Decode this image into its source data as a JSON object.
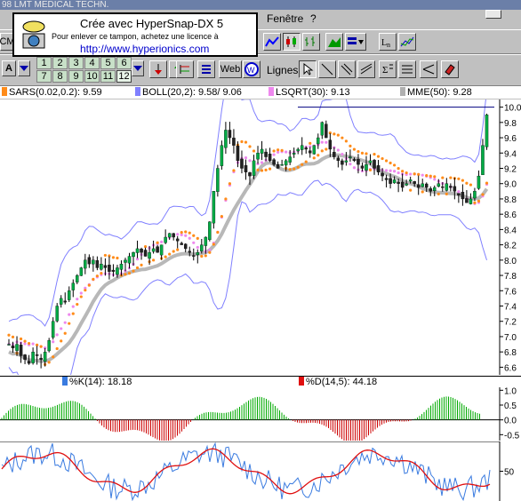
{
  "titlebar": {
    "text": "98  LMT MEDICAL TECHN."
  },
  "menubar": {
    "items": [
      {
        "label": "Fenêtre"
      },
      {
        "label": "?"
      }
    ]
  },
  "toolbar": {
    "left_stub": "CM",
    "tool_a": "A",
    "numbers": [
      "1",
      "2",
      "3",
      "4",
      "5",
      "6",
      "7",
      "8",
      "9",
      "10",
      "11",
      "12"
    ],
    "web_label": "Web",
    "lignes_label": "Lignes"
  },
  "watermark": {
    "line1": "Crée avec HyperSnap-DX 5",
    "line2": "Pour enlever ce tampon, achetez une licence à",
    "line3": "http://www.hyperionics.com"
  },
  "indicators_legend": [
    {
      "label": "SARS(0.02,0.2):",
      "value": "9.59",
      "color": "#ff8c1a"
    },
    {
      "label": "BOLL(20,2):",
      "value": "9.58/  9.06",
      "color": "#8080ff"
    },
    {
      "label": "LSQRT(30):",
      "value": "9.13",
      "color": "#ee88ee"
    },
    {
      "label": "MME(50):",
      "value": "9.28",
      "color": "#b0b0b0"
    }
  ],
  "oscillator_legend": [
    {
      "label": "%K(14):",
      "value": "18.18",
      "color": "#3a7be0"
    },
    {
      "label": "%D(14,5):",
      "value": "44.18",
      "color": "#e01010"
    }
  ],
  "chart_data": [
    {
      "type": "candlestick",
      "title": "",
      "y_ticks": [
        "10.0",
        "9.8",
        "9.6",
        "9.4",
        "9.2",
        "9.0",
        "8.8",
        "8.6",
        "8.4",
        "8.2",
        "8.0",
        "7.8",
        "7.6",
        "7.4",
        "7.2",
        "7.0",
        "6.8",
        "6.6"
      ],
      "ylim": [
        6.5,
        10.1
      ],
      "close_series": [
        6.9,
        6.85,
        6.9,
        6.75,
        6.7,
        6.65,
        6.8,
        6.75,
        6.7,
        6.8,
        6.95,
        7.2,
        7.4,
        7.5,
        7.45,
        7.6,
        7.7,
        7.8,
        7.9,
        8.0,
        7.95,
        8.0,
        7.9,
        7.95,
        7.9,
        7.85,
        7.85,
        7.9,
        7.95,
        8.0,
        8.05,
        8.1,
        8.15,
        8.1,
        8.05,
        8.1,
        8.15,
        8.1,
        8.2,
        8.3,
        8.35,
        8.3,
        8.25,
        8.2,
        8.15,
        8.1,
        8.05,
        8.1,
        8.2,
        8.3,
        8.5,
        8.9,
        9.2,
        9.5,
        9.7,
        9.6,
        9.5,
        9.3,
        9.2,
        9.15,
        9.1,
        9.3,
        9.4,
        9.45,
        9.35,
        9.3,
        9.25,
        9.2,
        9.25,
        9.3,
        9.35,
        9.4,
        9.45,
        9.5,
        9.45,
        9.4,
        9.5,
        9.6,
        9.8,
        9.6,
        9.45,
        9.35,
        9.3,
        9.25,
        9.3,
        9.35,
        9.3,
        9.25,
        9.2,
        9.25,
        9.3,
        9.2,
        9.15,
        9.1,
        9.05,
        9.0,
        9.05,
        9.0,
        8.95,
        9.0,
        9.05,
        9.0,
        8.95,
        9.0,
        8.95,
        8.9,
        8.95,
        9.0,
        8.95,
        9.0,
        8.95,
        8.9,
        8.85,
        8.8,
        8.75,
        8.8,
        8.9,
        9.1,
        9.5,
        9.9
      ],
      "resistance_line": 10.0
    },
    {
      "type": "line",
      "title": "",
      "y_ticks": [
        "1.0",
        "0.5",
        "0.0",
        "-0.5"
      ],
      "ylim": [
        -0.7,
        1.1
      ],
      "note": "momentum histogram"
    },
    {
      "type": "line",
      "title": "",
      "y_ticks": [
        "50"
      ],
      "ylim": [
        0,
        100
      ],
      "series": [
        {
          "name": "%K(14)",
          "color": "#3a7be0"
        },
        {
          "name": "%D(14,5)",
          "color": "#e01010"
        }
      ]
    }
  ]
}
